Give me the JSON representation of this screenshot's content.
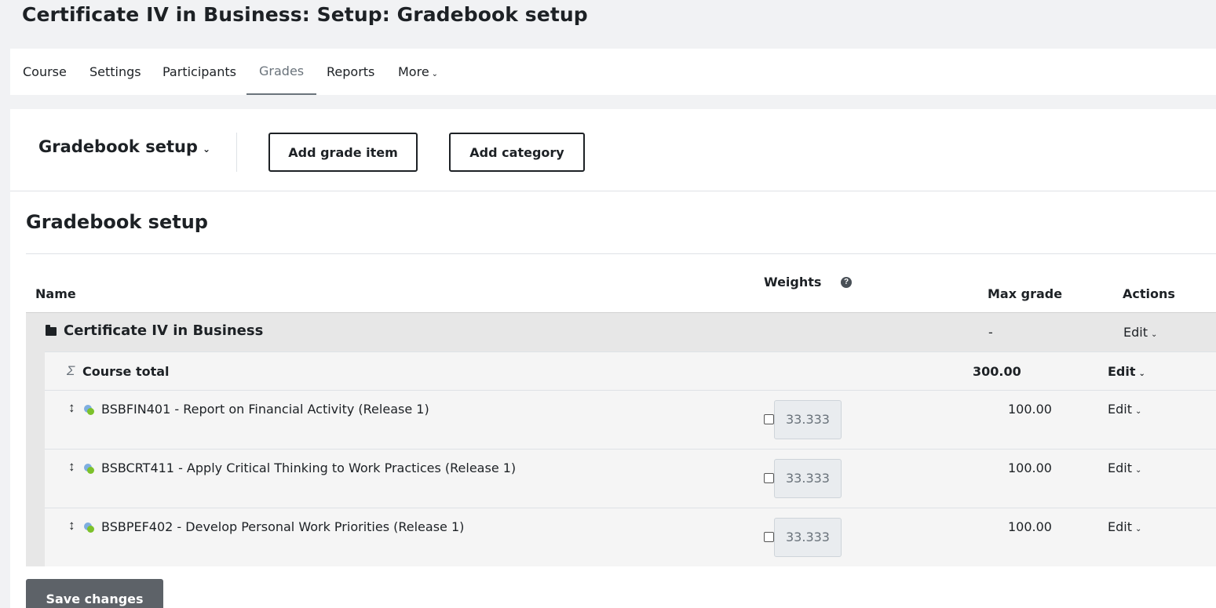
{
  "page": {
    "title": "Certificate IV in Business: Setup: Gradebook setup"
  },
  "nav": {
    "items": [
      {
        "label": "Course"
      },
      {
        "label": "Settings"
      },
      {
        "label": "Participants"
      },
      {
        "label": "Grades",
        "active": true
      },
      {
        "label": "Reports"
      },
      {
        "label": "More"
      }
    ]
  },
  "action_bar": {
    "selector_label": "Gradebook setup",
    "add_grade_item_label": "Add grade item",
    "add_category_label": "Add category"
  },
  "heading": "Gradebook setup",
  "table": {
    "headers": {
      "name": "Name",
      "weights": "Weights",
      "max_grade": "Max grade",
      "actions": "Actions"
    },
    "category": {
      "name": "Certificate IV in Business",
      "max_grade": "-",
      "action": "Edit"
    },
    "total": {
      "name": "Course total",
      "max_grade": "300.00",
      "action": "Edit"
    },
    "items": [
      {
        "name": "BSBFIN401 - Report on Financial Activity (Release 1)",
        "weight": "33.333",
        "max_grade": "100.00",
        "action": "Edit"
      },
      {
        "name": "BSBCRT411 - Apply Critical Thinking to Work Practices (Release 1)",
        "weight": "33.333",
        "max_grade": "100.00",
        "action": "Edit"
      },
      {
        "name": "BSBPEF402 - Develop Personal Work Priorities (Release 1)",
        "weight": "33.333",
        "max_grade": "100.00",
        "action": "Edit"
      }
    ]
  },
  "save_label": "Save changes",
  "colors": {
    "save_bg": "#5d6268",
    "category_bg": "#e7e7e7",
    "row_bg": "#f5f5f5",
    "assign_icon_green": "#7cc12b",
    "assign_icon_blue": "#2f7fd0"
  }
}
